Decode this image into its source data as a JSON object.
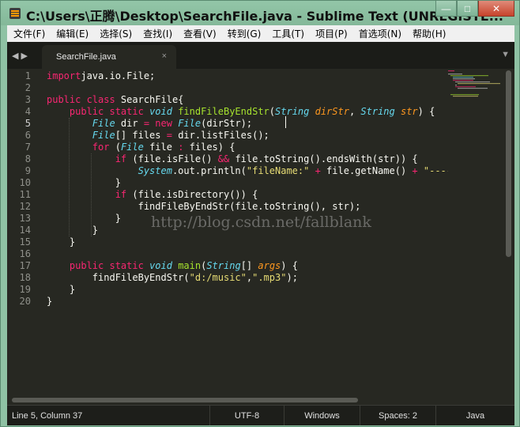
{
  "window": {
    "title": "C:\\Users\\正腾\\Desktop\\SearchFile.java - Sublime Text (UNREGISTE...",
    "minimize_label": "—",
    "maximize_label": "□",
    "close_label": "✕"
  },
  "menu": {
    "items": [
      "文件(F)",
      "编辑(E)",
      "选择(S)",
      "查找(I)",
      "查看(V)",
      "转到(G)",
      "工具(T)",
      "项目(P)",
      "首选项(N)",
      "帮助(H)"
    ]
  },
  "tabs": {
    "nav": "◀ ▶",
    "active_tab": "SearchFile.java",
    "close_glyph": "×",
    "dropdown_glyph": "▼"
  },
  "editor": {
    "line_numbers": [
      "1",
      "2",
      "3",
      "4",
      "5",
      "6",
      "7",
      "8",
      "9",
      "10",
      "11",
      "12",
      "13",
      "14",
      "15",
      "16",
      "17",
      "18",
      "19",
      "20"
    ],
    "active_line": 5,
    "lines": [
      [
        [
          "kw",
          "import"
        ],
        [
          "",
          "java.io.File;"
        ]
      ],
      [],
      [
        [
          "kw",
          "public class "
        ],
        [
          "",
          "SearchFile{"
        ]
      ],
      [
        [
          "",
          "    "
        ],
        [
          "kw",
          "public static "
        ],
        [
          "st",
          "void "
        ],
        [
          "fn",
          "findFileByEndStr"
        ],
        [
          "",
          "("
        ],
        [
          "st",
          "String "
        ],
        [
          "par",
          "dirStr"
        ],
        [
          "",
          ", "
        ],
        [
          "st",
          "String "
        ],
        [
          "par",
          "str"
        ],
        [
          "",
          ") {"
        ]
      ],
      [
        [
          "",
          "        "
        ],
        [
          "st",
          "File "
        ],
        [
          "",
          "dir "
        ],
        [
          "kw",
          "= new "
        ],
        [
          "st",
          "File"
        ],
        [
          "",
          "(dirStr);"
        ]
      ],
      [
        [
          "",
          "        "
        ],
        [
          "st",
          "File"
        ],
        [
          "",
          "[] files "
        ],
        [
          "kw",
          "= "
        ],
        [
          "",
          "dir.listFiles();"
        ]
      ],
      [
        [
          "",
          "        "
        ],
        [
          "kw",
          "for "
        ],
        [
          "",
          "("
        ],
        [
          "st",
          "File "
        ],
        [
          "",
          "file "
        ],
        [
          "kw",
          ": "
        ],
        [
          "",
          "files) {"
        ]
      ],
      [
        [
          "",
          "            "
        ],
        [
          "kw",
          "if "
        ],
        [
          "",
          "(file.isFile() "
        ],
        [
          "kw",
          "&& "
        ],
        [
          "",
          "file.toString().endsWith(str)) {"
        ]
      ],
      [
        [
          "",
          "                "
        ],
        [
          "st",
          "System"
        ],
        [
          "",
          ".out.println("
        ],
        [
          "str",
          "\"fileName:\""
        ],
        [
          "kw",
          " + "
        ],
        [
          "",
          "file.getName() "
        ],
        [
          "kw",
          "+ "
        ],
        [
          "str",
          "\"-----"
        ]
      ],
      [
        [
          "",
          "            }"
        ]
      ],
      [
        [
          "",
          "            "
        ],
        [
          "kw",
          "if "
        ],
        [
          "",
          "(file.isDirectory()) {"
        ]
      ],
      [
        [
          "",
          "                findFileByEndStr(file.toString(), str);"
        ]
      ],
      [
        [
          "",
          "            }"
        ]
      ],
      [
        [
          "",
          "        }"
        ]
      ],
      [
        [
          "",
          "    }"
        ]
      ],
      [],
      [
        [
          "",
          "    "
        ],
        [
          "kw",
          "public static "
        ],
        [
          "st",
          "void "
        ],
        [
          "fn",
          "main"
        ],
        [
          "",
          "("
        ],
        [
          "st",
          "String"
        ],
        [
          "",
          "[] "
        ],
        [
          "par",
          "args"
        ],
        [
          "",
          ") {"
        ]
      ],
      [
        [
          "",
          "        findFileByEndStr("
        ],
        [
          "str",
          "\"d:/music\""
        ],
        [
          "",
          ","
        ],
        [
          "str",
          "\".mp3\""
        ],
        [
          "",
          ");"
        ]
      ],
      [
        [
          "",
          "    }"
        ]
      ],
      [
        [
          "",
          "}"
        ]
      ]
    ],
    "watermark": "http://blog.csdn.net/fallblank"
  },
  "status": {
    "position": "Line 5, Column 37",
    "encoding": "UTF-8",
    "line_endings": "Windows",
    "indentation": "Spaces: 2",
    "syntax": "Java"
  },
  "colors": {
    "keyword": "#f92672",
    "storage_type": "#66d9ef",
    "function": "#a6e22e",
    "parameter": "#fd971f",
    "string": "#e6db74",
    "background": "#272822"
  }
}
